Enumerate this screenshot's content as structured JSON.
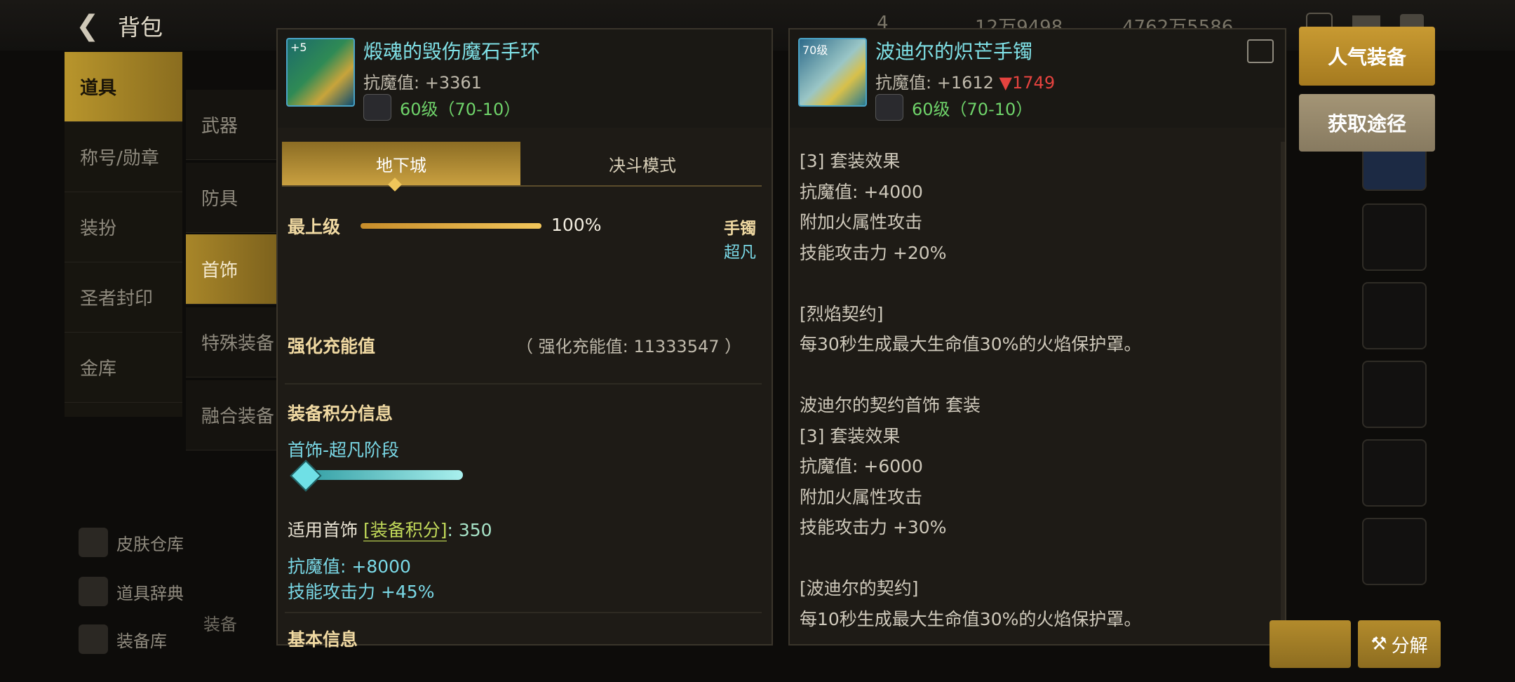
{
  "topbar": {
    "back_label": "背包",
    "resource1": "4",
    "resource2": "12万9498",
    "resource3": "4762万5586"
  },
  "leftnav": {
    "items": [
      {
        "label": "道具",
        "active": true
      },
      {
        "label": "称号/勋章"
      },
      {
        "label": "装扮"
      },
      {
        "label": "圣者封印"
      },
      {
        "label": "金库"
      }
    ]
  },
  "subnav": {
    "items": [
      {
        "label": "武器"
      },
      {
        "label": "防具"
      },
      {
        "label": "首饰",
        "active": true
      },
      {
        "label": "特殊装备"
      },
      {
        "label": "融合装备"
      }
    ]
  },
  "bottomleft": {
    "items": [
      {
        "label": "皮肤仓库",
        "icon": "skin-icon"
      },
      {
        "label": "道具辞典",
        "icon": "dictionary-icon"
      },
      {
        "label": "装备库",
        "icon": "armory-icon"
      }
    ],
    "extra": "装备"
  },
  "left_panel": {
    "item_name": "煅魂的毁伤魔石手环",
    "icon_badge": "+5",
    "resist_label": "抗魔值: ",
    "resist_value": "+3361",
    "level": "60级（70-10）",
    "tabs": [
      "地下城",
      "决斗模式"
    ],
    "grade_label": "最上级",
    "grade_percent": 100,
    "grade_percent_text": "100%",
    "slot_type": "手镯",
    "rarity": "超凡",
    "enhance_label": "强化充能值",
    "enhance_value": "（ 强化充能值: 11333547 ）",
    "score_title": "装备积分信息",
    "score_stage": "首饰-超凡阶段",
    "score_progress": 1.0,
    "score_line_prefix": "适用首饰 ",
    "score_line_link": "[装备积分]",
    "score_line_value": ": 350",
    "bonus_resist": "抗魔值: +8000",
    "bonus_skill": "技能攻击力 +45%",
    "basic_info": "基本信息"
  },
  "right_panel": {
    "item_name": "波迪尔的炽芒手镯",
    "icon_badge": "70级",
    "resist_label": "抗魔值: ",
    "resist_value": "+1612",
    "resist_diff": "▼1749",
    "level": "60级（70-10）",
    "lines": [
      "[3] 套装效果",
      "抗魔值: +4000",
      "附加火属性攻击",
      "技能攻击力 +20%",
      "",
      "[烈焰契约]",
      "每30秒生成最大生命值30%的火焰保护罩。",
      "",
      "波迪尔的契约首饰 套装",
      "[3] 套装效果",
      "抗魔值: +6000",
      "附加火属性攻击",
      "技能攻击力 +30%",
      "",
      "[波迪尔的契约]",
      "每10秒生成最大生命值30%的火焰保护罩。"
    ]
  },
  "side_buttons": {
    "popular": "人气装备",
    "source": "获取途径"
  },
  "bottom_buttons": {
    "decompose": "分解"
  },
  "colors": {
    "gold": "#c89a32",
    "cyan": "#7fe0e6",
    "green": "#6fd36a",
    "red": "#e5433f"
  }
}
